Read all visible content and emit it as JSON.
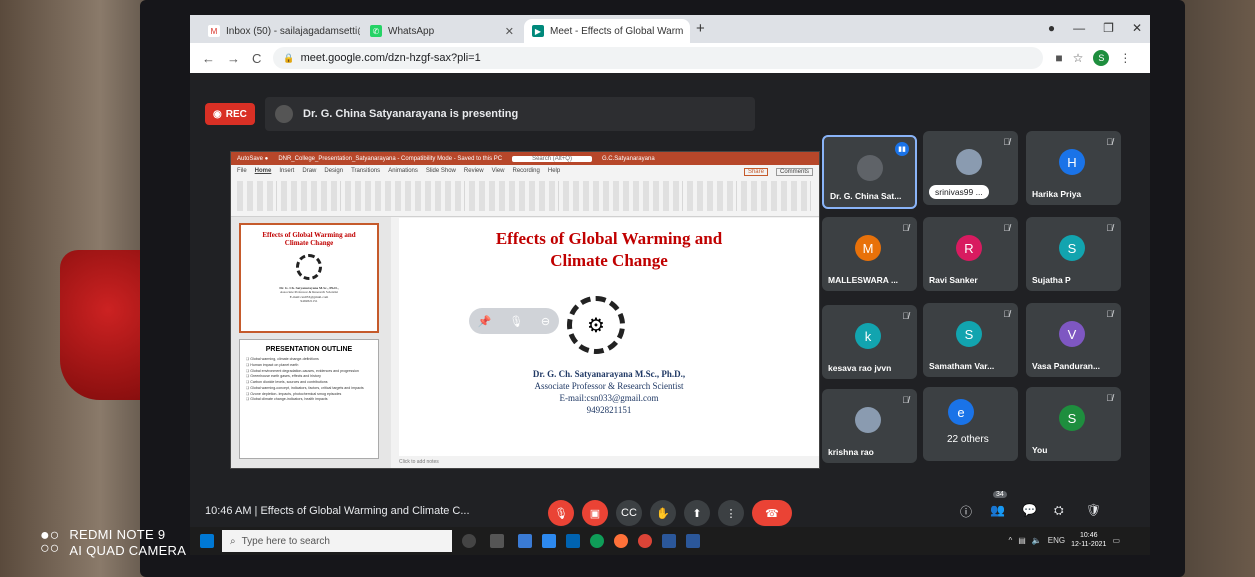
{
  "browser": {
    "tabs": [
      {
        "title": "Inbox (50) - sailajagadamsetti@s",
        "icon": "gmail-icon",
        "color": "#d93025"
      },
      {
        "title": "WhatsApp",
        "icon": "whatsapp-icon",
        "color": "#25d366"
      },
      {
        "title": "Meet - Effects of Global Warm",
        "icon": "meet-icon",
        "color": "#00897b",
        "active": true
      }
    ],
    "url": "meet.google.com/dzn-hzgf-sax?pli=1",
    "profile_initial": "S"
  },
  "meet": {
    "rec_label": "REC",
    "presenting_banner": "Dr. G. China Satyanarayana is presenting",
    "time": "10:46 AM",
    "separator": "|",
    "meeting_title": "Effects of Global Warming and Climate C...",
    "participant_count": "34",
    "participants": [
      {
        "name": "Dr. G. China Sat...",
        "initial": "",
        "color": "#5f6368",
        "speaking": true
      },
      {
        "name": "srinivas99 ...",
        "initial": "",
        "color": "#8a9bb0"
      },
      {
        "name": "Harika Priya",
        "initial": "H",
        "color": "#1a73e8"
      },
      {
        "name": "MALLESWARA ...",
        "initial": "M",
        "color": "#e8710a"
      },
      {
        "name": "Ravi Sanker",
        "initial": "R",
        "color": "#d81b60"
      },
      {
        "name": "Sujatha P",
        "initial": "S",
        "color": "#12a4af"
      },
      {
        "name": "kesava rao jvvn",
        "initial": "k",
        "color": "#12a4af"
      },
      {
        "name": "Samatham Var...",
        "initial": "S",
        "color": "#12a4af"
      },
      {
        "name": "Vasa Panduran...",
        "initial": "V",
        "color": "#7e57c2"
      },
      {
        "name": "krishna rao",
        "initial": "",
        "color": "#8a9bb0"
      },
      {
        "name": "22 others",
        "initial": "e",
        "color": "#1a73e8"
      },
      {
        "name": "You",
        "initial": "S",
        "color": "#1e8e3e"
      }
    ]
  },
  "presentation": {
    "app_title": "DNR_College_Presentation_Satyanarayana - Compatibility Mode - Saved to this PC",
    "search_hint": "Search (Alt+Q)",
    "user": "G.C.Satyanarayana",
    "ribbon_tabs": [
      "File",
      "Home",
      "Insert",
      "Draw",
      "Design",
      "Transitions",
      "Animations",
      "Slide Show",
      "Review",
      "View",
      "Recording",
      "Help"
    ],
    "share_label": "Share",
    "comments_label": "Comments",
    "slide_title_line1": "Effects of Global Warming and",
    "slide_title_line2": "Climate Change",
    "author_name": "Dr. G. Ch. Satyanarayana M.Sc., Ph.D.,",
    "author_title": "Associate Professor & Research Scientist",
    "author_email": "E-mail:csn033@gmail.com",
    "author_phone": "9492821151",
    "thumb1_title": "Effects of Global Warming and Climate Change",
    "thumb1_author": "Dr. G. Ch. Satyanarayana M.Sc., Ph.D.,",
    "thumb1_role": "Associate Professor & Research Scientist",
    "thumb2_head": "PRESENTATION OUTLINE",
    "outline": [
      "Global warming, climate change-definitions",
      "Human impact on planet earth",
      "Global environment degradation-causes, evidences and progression",
      "Greenhouse earth gases, effects and history",
      "Carbon dioxide levels, sources and contributions",
      "Global warming-concept, indicators, factors, critical targets and impacts",
      "Ozone depletion- impacts, photochemical smog episodes",
      "Global climate change-indicators, health impacts"
    ],
    "notes_hint": "Click to add notes"
  },
  "taskbar": {
    "search_placeholder": "Type here to search",
    "lang": "ENG",
    "clock_time": "10:46",
    "clock_date": "12-11-2021"
  },
  "camera": {
    "line1": "REDMI NOTE 9",
    "line2": "AI QUAD CAMERA"
  }
}
